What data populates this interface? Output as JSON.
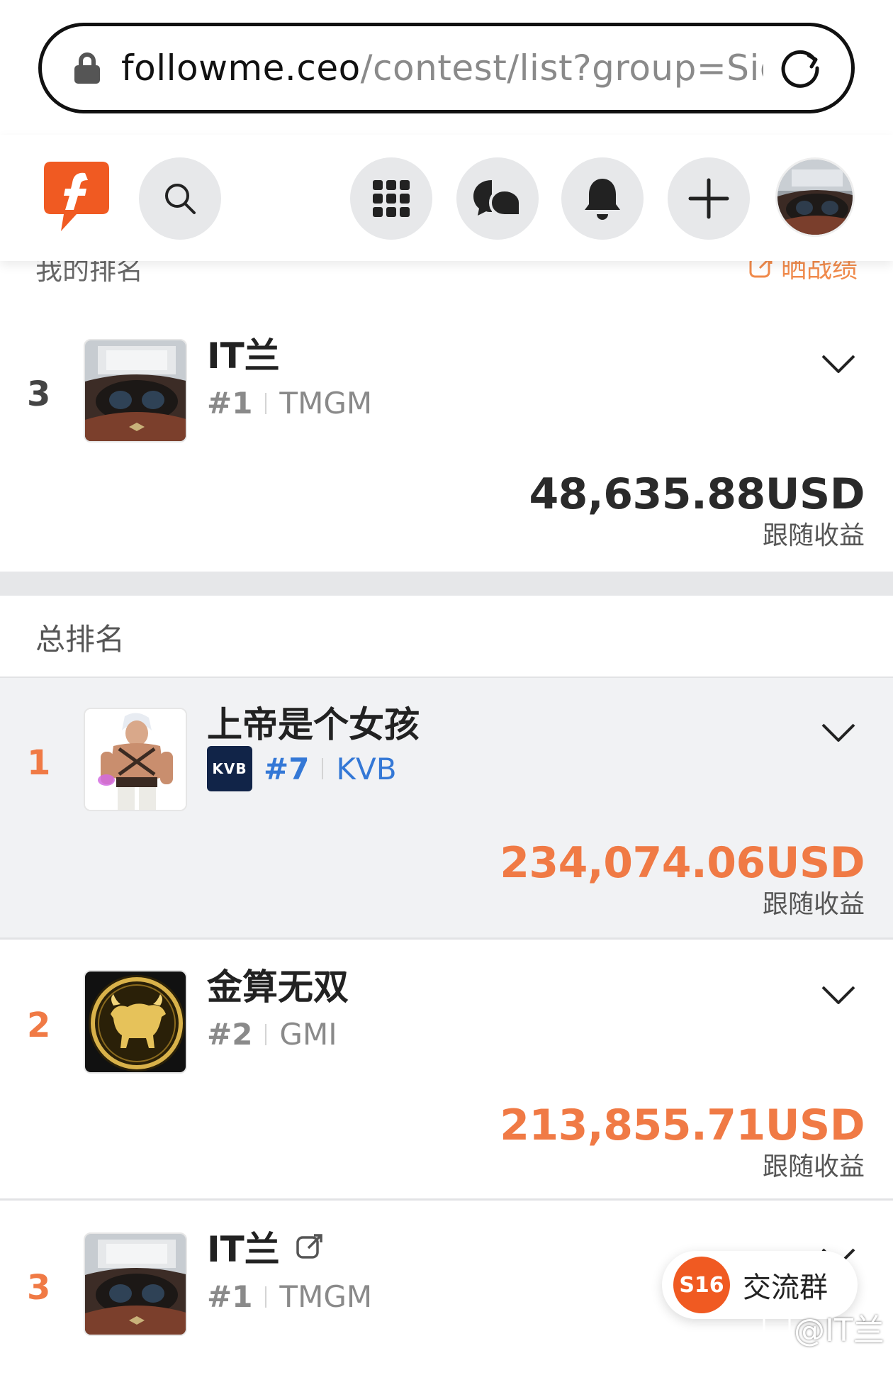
{
  "browser": {
    "url_domain": "followme.ceo",
    "url_path": "/contest/list?group=Sign"
  },
  "icons": {
    "lock": "lock-icon",
    "reload": "reload-icon",
    "logo": "followme-logo",
    "search": "search-icon",
    "apps": "grid-icon",
    "chat": "chat-bubbles-icon",
    "bell": "bell-icon",
    "plus": "plus-icon"
  },
  "my_ranking": {
    "label": "我的排名",
    "share_label": "晒战绩",
    "entry": {
      "rank": "3",
      "name": "IT兰",
      "num": "#1",
      "broker": "TMGM",
      "amount": "48,635.88USD",
      "caption": "跟随收益"
    }
  },
  "overall": {
    "label": "总排名",
    "entries": [
      {
        "rank": "1",
        "name": "上帝是个女孩",
        "badge": "KVB",
        "num": "#7",
        "broker": "KVB",
        "amount": "234,074.06USD",
        "caption": "跟随收益"
      },
      {
        "rank": "2",
        "name": "金算无双",
        "num": "#2",
        "broker": "GMI",
        "amount": "213,855.71USD",
        "caption": "跟随收益"
      },
      {
        "rank": "3",
        "name": "IT兰",
        "num": "#1",
        "broker": "TMGM"
      }
    ]
  },
  "chat": {
    "badge": "S16",
    "label": "交流群"
  },
  "watermark": "@IT兰",
  "colors": {
    "accent": "#f07a45",
    "brand": "#f05a22",
    "link": "#3478d6"
  }
}
